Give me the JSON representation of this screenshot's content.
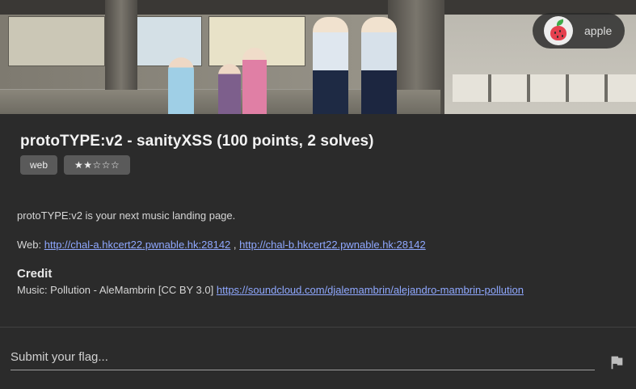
{
  "header": {
    "user": {
      "name": "apple",
      "avatar_icon": "apple-avatar-icon"
    }
  },
  "challenge": {
    "title": "protoTYPE:v2 - sanityXSS (100 points, 2 solves)",
    "tags": [
      "web",
      "★★☆☆☆"
    ],
    "description": "protoTYPE:v2 is your next music landing page.",
    "web_label": "Web:",
    "web_link_a": "http://chal-a.hkcert22.pwnable.hk:28142",
    "web_separator": ",",
    "web_link_b": "http://chal-b.hkcert22.pwnable.hk:28142",
    "credit_heading": "Credit",
    "music_credit": "Music: Pollution - AleMambrin [CC BY 3.0]",
    "music_link": "https://soundcloud.com/djalemambrin/alejandro-mambrin-pollution"
  },
  "submit": {
    "placeholder": "Submit your flag...",
    "value": "",
    "button_icon": "flag-icon"
  },
  "colors": {
    "background": "#2b2b2b",
    "link": "#8fa8ff",
    "tag_bg": "#5a5a5a"
  }
}
